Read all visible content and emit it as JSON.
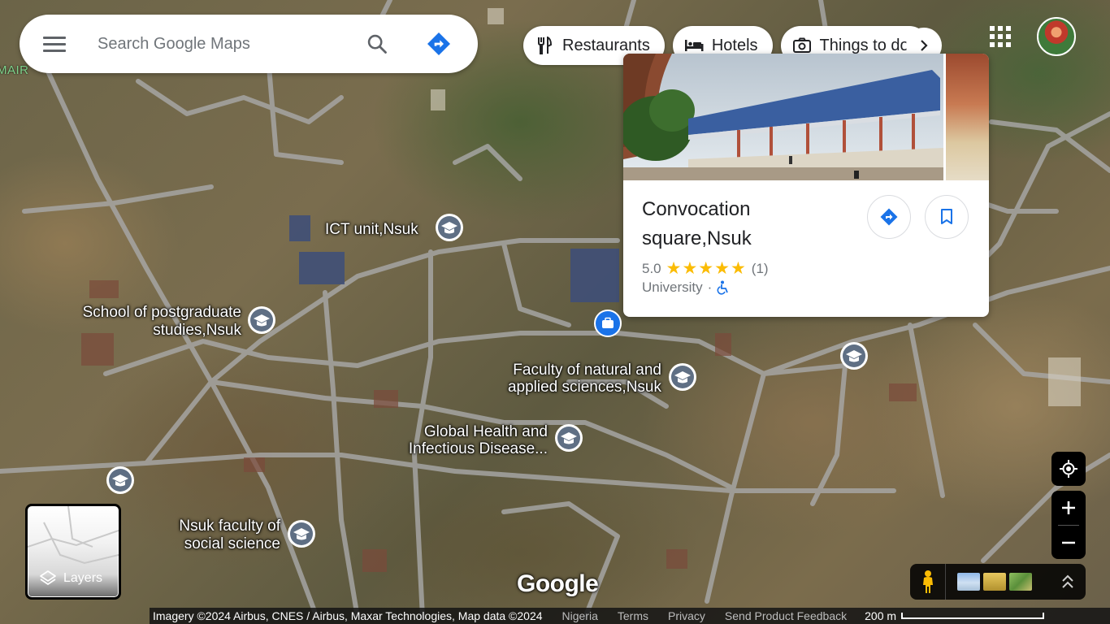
{
  "search": {
    "placeholder": "Search Google Maps"
  },
  "chips": [
    {
      "label": "Restaurants",
      "icon": "fork-knife-icon"
    },
    {
      "label": "Hotels",
      "icon": "bed-icon"
    },
    {
      "label": "Things to do",
      "icon": "camera-icon"
    }
  ],
  "place_card": {
    "title": "Convocation square,Nsuk",
    "rating": "5.0",
    "stars": "★★★★★",
    "review_count": "(1)",
    "category": "University",
    "separator": "·",
    "accessibility_icon": "wheelchair-icon"
  },
  "map_labels": {
    "edge_text": "MAIR",
    "ict": "ICT unit,Nsuk",
    "postgrad_line1": "School of postgraduate",
    "postgrad_line2": "studies,Nsuk",
    "natural_line1": "Faculty of natural and",
    "natural_line2": "applied sciences,Nsuk",
    "global_line1": "Global Health and",
    "global_line2": "Infectious Disease...",
    "social_line1": "Nsuk faculty of",
    "social_line2": "social science"
  },
  "layers": {
    "label": "Layers"
  },
  "google_logo": "Google",
  "attribution": {
    "copyright": "Imagery ©2024 Airbus, CNES / Airbus, Maxar Technologies, Map data ©2024",
    "country": "Nigeria",
    "terms": "Terms",
    "privacy": "Privacy",
    "feedback": "Send Product Feedback",
    "scale": "200 m"
  },
  "colors": {
    "accent": "#1a73e8",
    "star": "#fbbc04"
  }
}
